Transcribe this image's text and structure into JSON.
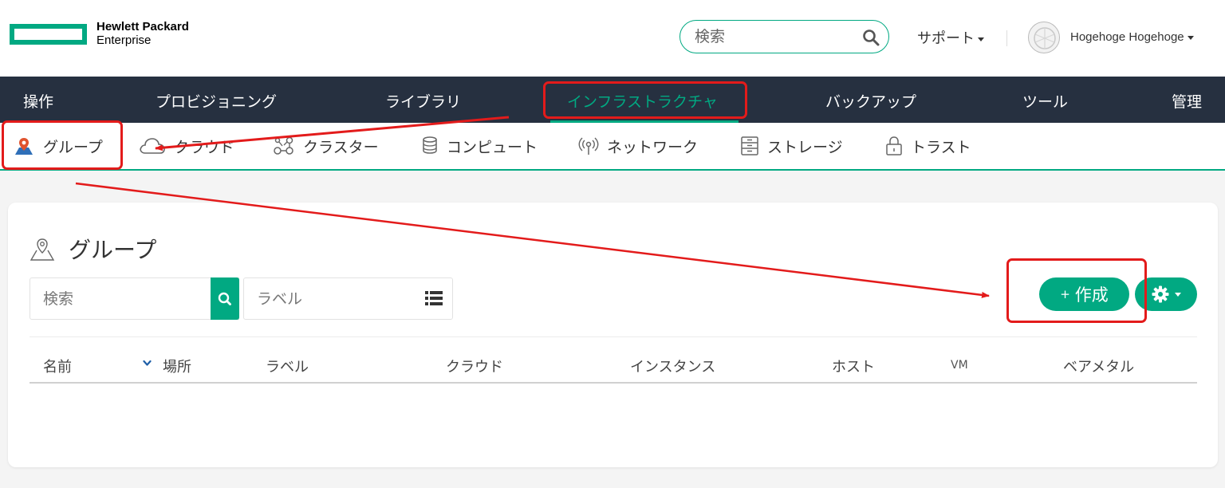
{
  "brand": {
    "line1": "Hewlett Packard",
    "line2": "Enterprise",
    "color": "#01a982"
  },
  "header": {
    "search_placeholder": "検索",
    "support_label": "サポート",
    "user_name": "Hogehoge Hogehoge"
  },
  "main_nav": {
    "items": [
      {
        "label": "操作"
      },
      {
        "label": "プロビジョニング"
      },
      {
        "label": "ライブラリ"
      },
      {
        "label": "インフラストラクチャ",
        "active": true
      },
      {
        "label": "バックアップ"
      },
      {
        "label": "ツール"
      },
      {
        "label": "管理"
      }
    ],
    "background": "#263040",
    "active_color": "#01a982"
  },
  "sub_nav": {
    "items": [
      {
        "label": "グループ",
        "icon": "map-pin-icon",
        "active": true
      },
      {
        "label": "クラウド",
        "icon": "cloud-icon"
      },
      {
        "label": "クラスター",
        "icon": "cluster-icon"
      },
      {
        "label": "コンピュート",
        "icon": "database-icon"
      },
      {
        "label": "ネットワーク",
        "icon": "antenna-icon"
      },
      {
        "label": "ストレージ",
        "icon": "storage-icon"
      },
      {
        "label": "トラスト",
        "icon": "lock-icon"
      }
    ]
  },
  "page": {
    "title": "グループ",
    "search_placeholder": "検索",
    "label_placeholder": "ラベル",
    "create_label": "作成",
    "create_prefix": "+",
    "settings_icon": "gear-icon"
  },
  "table": {
    "columns": [
      "名前",
      "場所",
      "ラベル",
      "クラウド",
      "インスタンス",
      "ホスト",
      "VM",
      "ベアメタル"
    ],
    "sorted_column": "場所",
    "rows": []
  },
  "annotations": {
    "color": "#e31b1b"
  }
}
